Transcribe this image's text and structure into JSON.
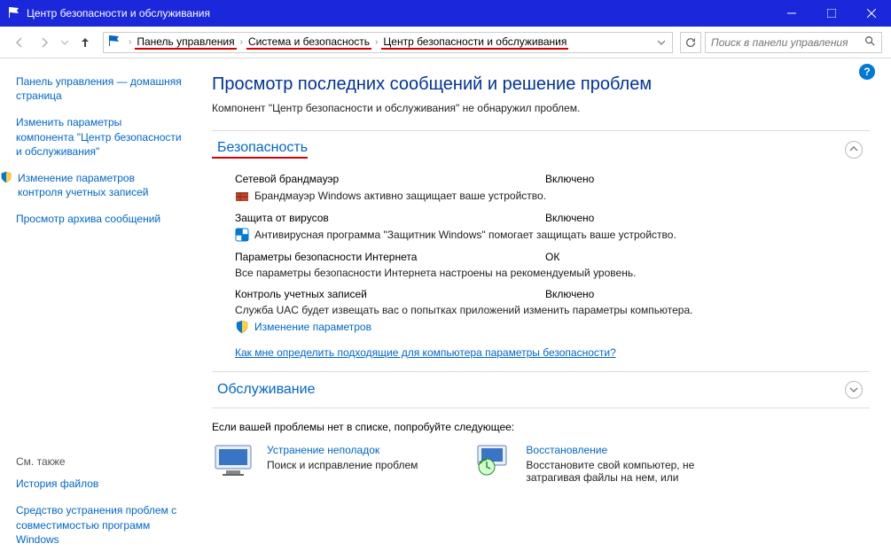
{
  "window": {
    "title": "Центр безопасности и обслуживания"
  },
  "breadcrumb": {
    "items": [
      "Панель управления",
      "Система и безопасность",
      "Центр безопасности и обслуживания"
    ]
  },
  "search": {
    "placeholder": "Поиск в панели управления"
  },
  "sidebar": {
    "links": [
      "Панель управления — домашняя страница",
      "Изменить параметры компонента \"Центр безопасности и обслуживания\"",
      "Изменение параметров контроля учетных записей",
      "Просмотр архива сообщений"
    ],
    "see_also_header": "См. также",
    "see_also": [
      "История файлов",
      "Средство устранения проблем с совместимостью программ Windows"
    ]
  },
  "main": {
    "heading": "Просмотр последних сообщений и решение проблем",
    "subtext": "Компонент \"Центр безопасности и обслуживания\" не обнаружил проблем.",
    "security": {
      "title": "Безопасность",
      "items": [
        {
          "label": "Сетевой брандмауэр",
          "status": "Включено",
          "desc": "Брандмауэр Windows активно защищает ваше устройство."
        },
        {
          "label": "Защита от вирусов",
          "status": "Включено",
          "desc": "Антивирусная программа \"Защитник Windows\" помогает защищать ваше устройство."
        },
        {
          "label": "Параметры безопасности Интернета",
          "status": "ОК",
          "desc": "Все параметры безопасности Интернета настроены на рекомендуемый уровень."
        },
        {
          "label": "Контроль учетных записей",
          "status": "Включено",
          "desc": "Служба UAC будет извещать вас о попытках приложений изменить параметры компьютера."
        }
      ],
      "change_params": "Изменение параметров",
      "help_link": "Как мне определить подходящие для компьютера параметры безопасности?"
    },
    "maintenance": {
      "title": "Обслуживание"
    },
    "footer": {
      "text": "Если вашей проблемы нет в списке, попробуйте следующее:",
      "actions": [
        {
          "label": "Устранение неполадок",
          "desc": "Поиск и исправление проблем"
        },
        {
          "label": "Восстановление",
          "desc": "Восстановите свой компьютер, не затрагивая файлы на нем, или"
        }
      ]
    }
  }
}
